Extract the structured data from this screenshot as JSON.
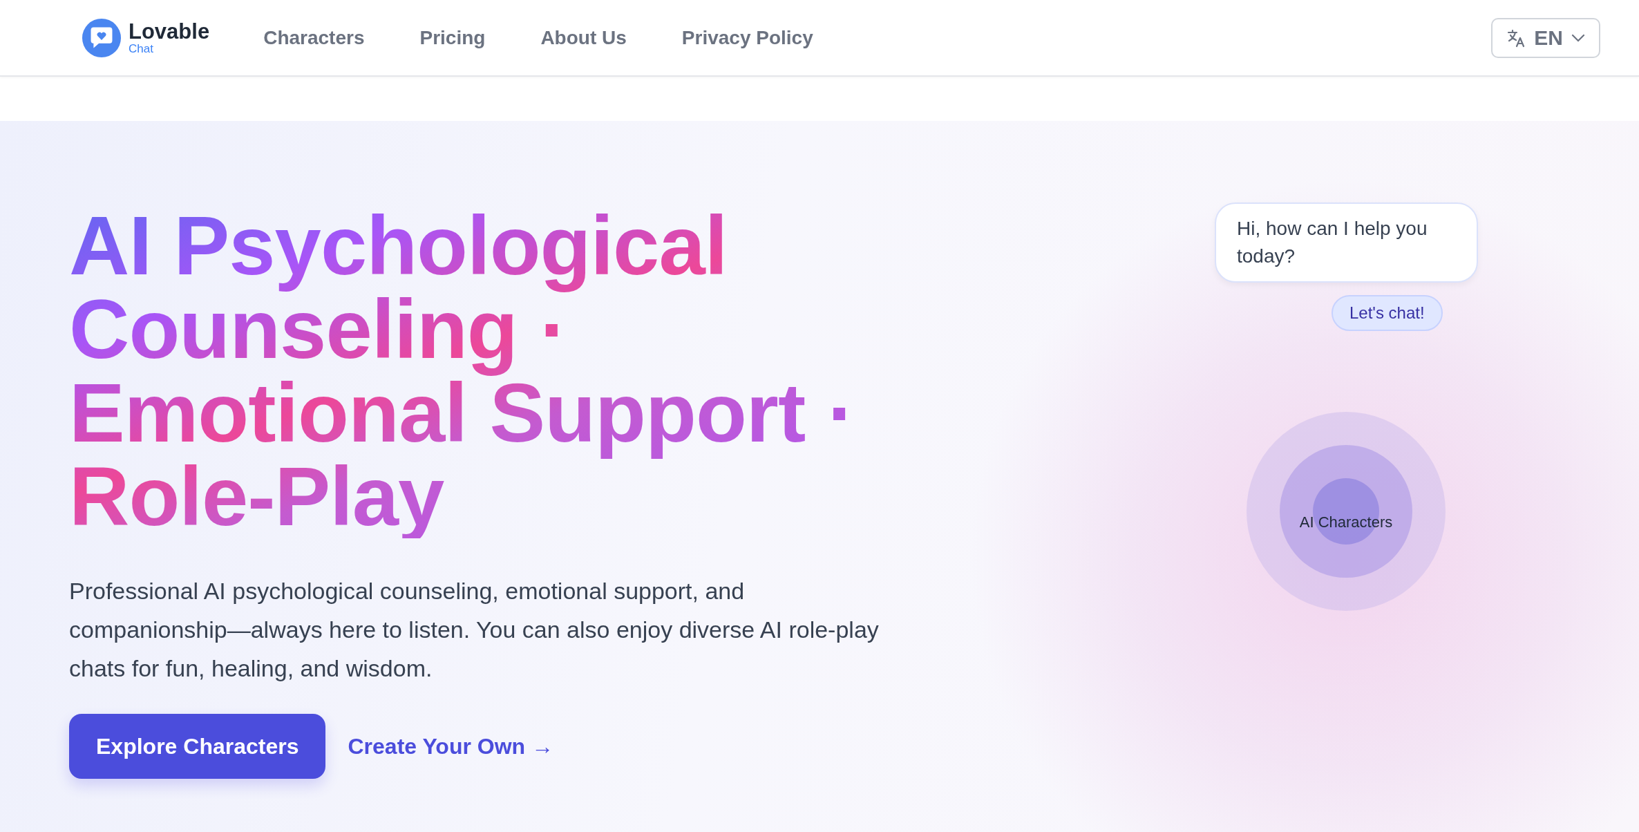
{
  "header": {
    "logo": {
      "name": "Lovable",
      "sub": "Chat"
    },
    "nav": [
      "Characters",
      "Pricing",
      "About Us",
      "Privacy Policy"
    ],
    "language": {
      "label": "EN"
    }
  },
  "hero": {
    "heading": "AI Psychological Counseling · Emotional Support · Role-Play",
    "description": "Professional AI psychological counseling, emotional support, and companionship—always here to listen. You can also enjoy diverse AI role-play chats for fun, healing, and wisdom.",
    "primary_button": "Explore Characters",
    "secondary_link": "Create Your Own →"
  },
  "chat": {
    "message": "Hi, how can I help you today?",
    "reply": "Let's chat!"
  },
  "orbit": {
    "label": "AI Characters"
  }
}
